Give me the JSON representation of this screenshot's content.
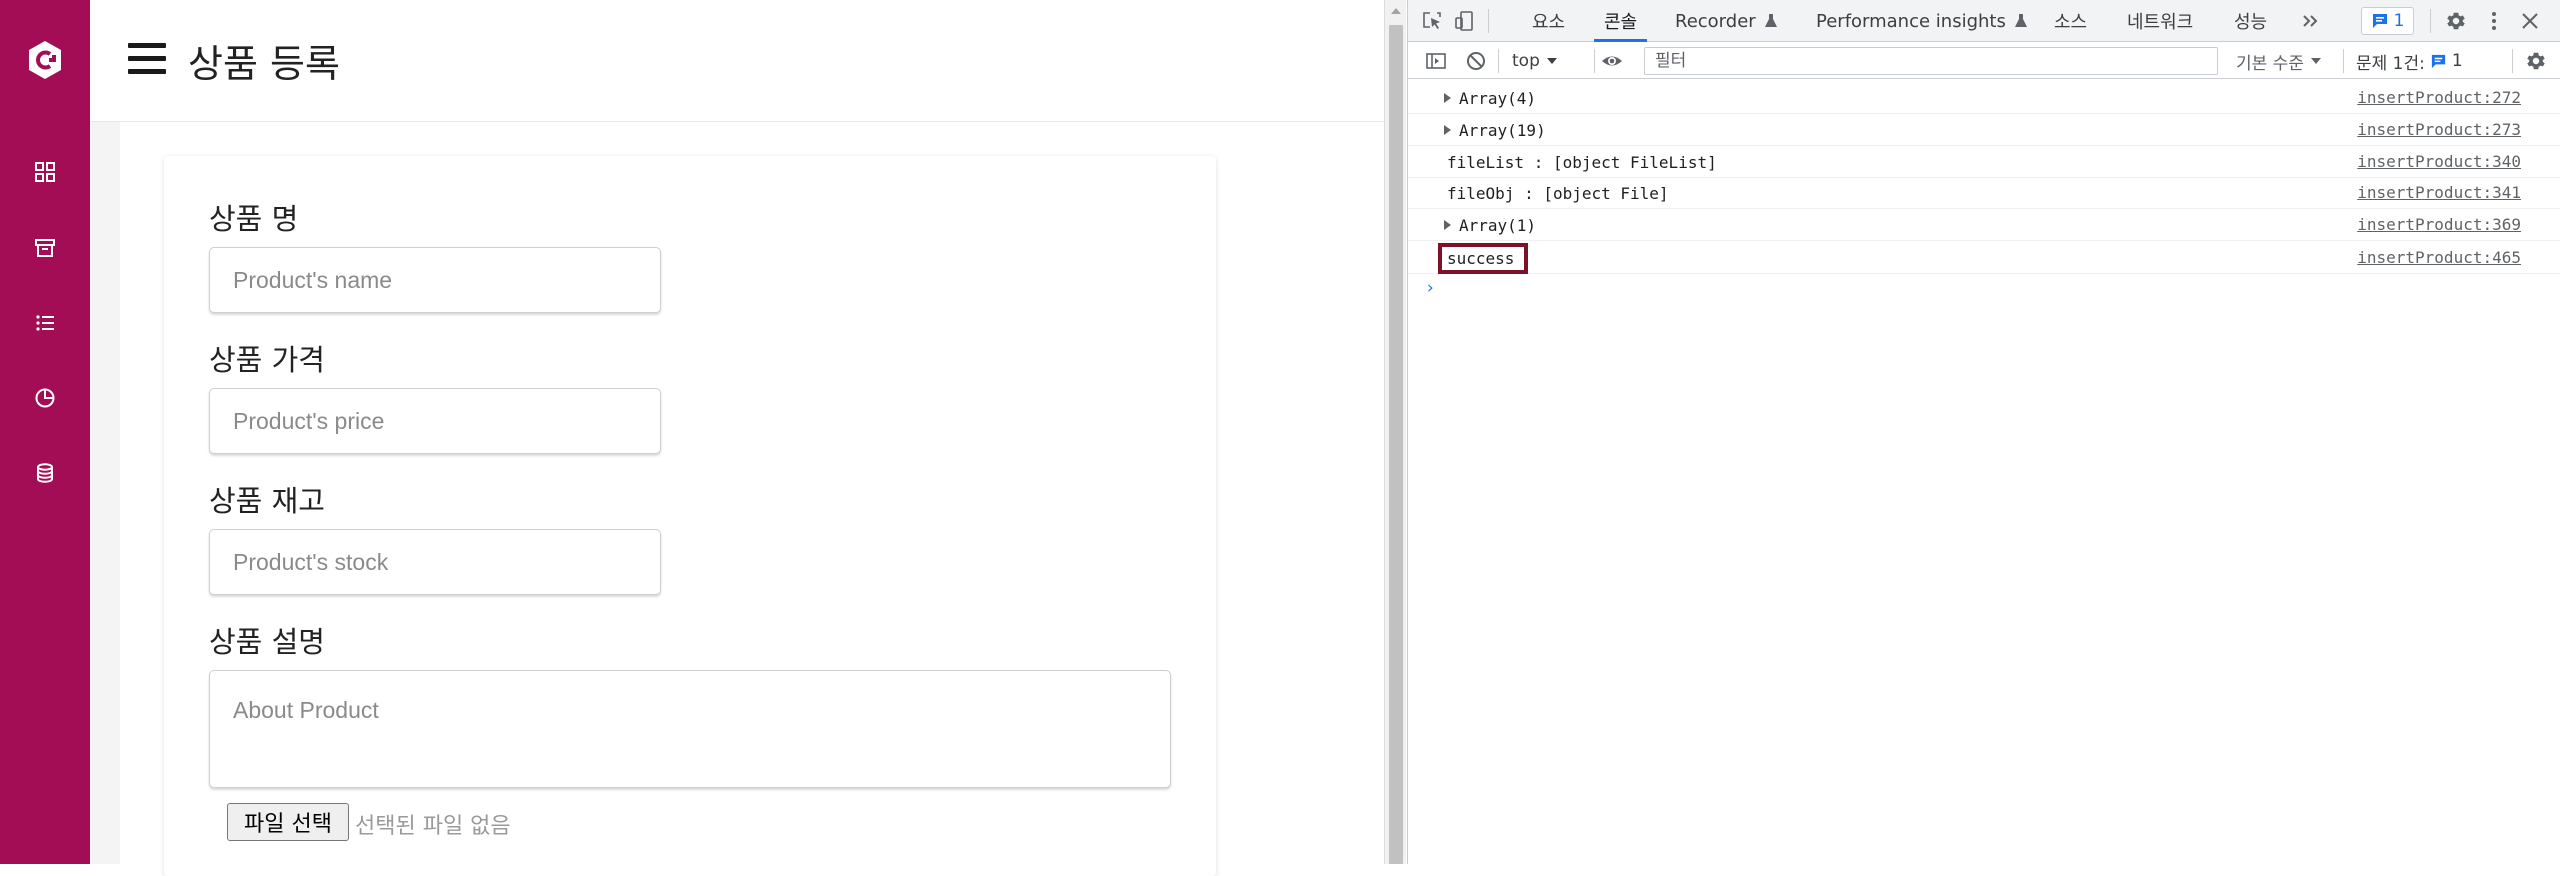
{
  "app": {
    "title": "상품 등록",
    "form": {
      "name_label": "상품 명",
      "name_placeholder": "Product's name",
      "price_label": "상품 가격",
      "price_placeholder": "Product's price",
      "stock_label": "상품 재고",
      "stock_placeholder": "Product's stock",
      "desc_label": "상품 설명",
      "desc_placeholder": "About Product",
      "file_button": "파일 선택",
      "file_status": "선택된 파일 없음"
    }
  },
  "sidebar": {
    "brand_color": "#a30d55",
    "items": [
      "dashboard-icon",
      "archive-icon",
      "list-icon",
      "pie-chart-icon",
      "database-icon"
    ]
  },
  "devtools": {
    "tabs": [
      "요소",
      "콘솔",
      "Recorder",
      "Performance insights",
      "소스",
      "네트워크",
      "성능"
    ],
    "active_tab": "콘솔",
    "issue_badge_count": "1",
    "toolbar": {
      "context": "top",
      "filter_placeholder": "필터",
      "levels": "기본 수준",
      "issues_label": "문제 1건:",
      "issues_count": "1"
    },
    "logs": [
      {
        "message": "Array(4)",
        "expandable": true,
        "source": "insertProduct:272"
      },
      {
        "message": "Array(19)",
        "expandable": true,
        "source": "insertProduct:273"
      },
      {
        "message": "fileList : [object FileList]",
        "expandable": false,
        "source": "insertProduct:340"
      },
      {
        "message": "fileObj : [object File]",
        "expandable": false,
        "source": "insertProduct:341"
      },
      {
        "message": "Array(1)",
        "expandable": true,
        "source": "insertProduct:369"
      },
      {
        "message": "success",
        "expandable": false,
        "source": "insertProduct:465",
        "highlighted": true
      }
    ],
    "prompt": "›"
  }
}
